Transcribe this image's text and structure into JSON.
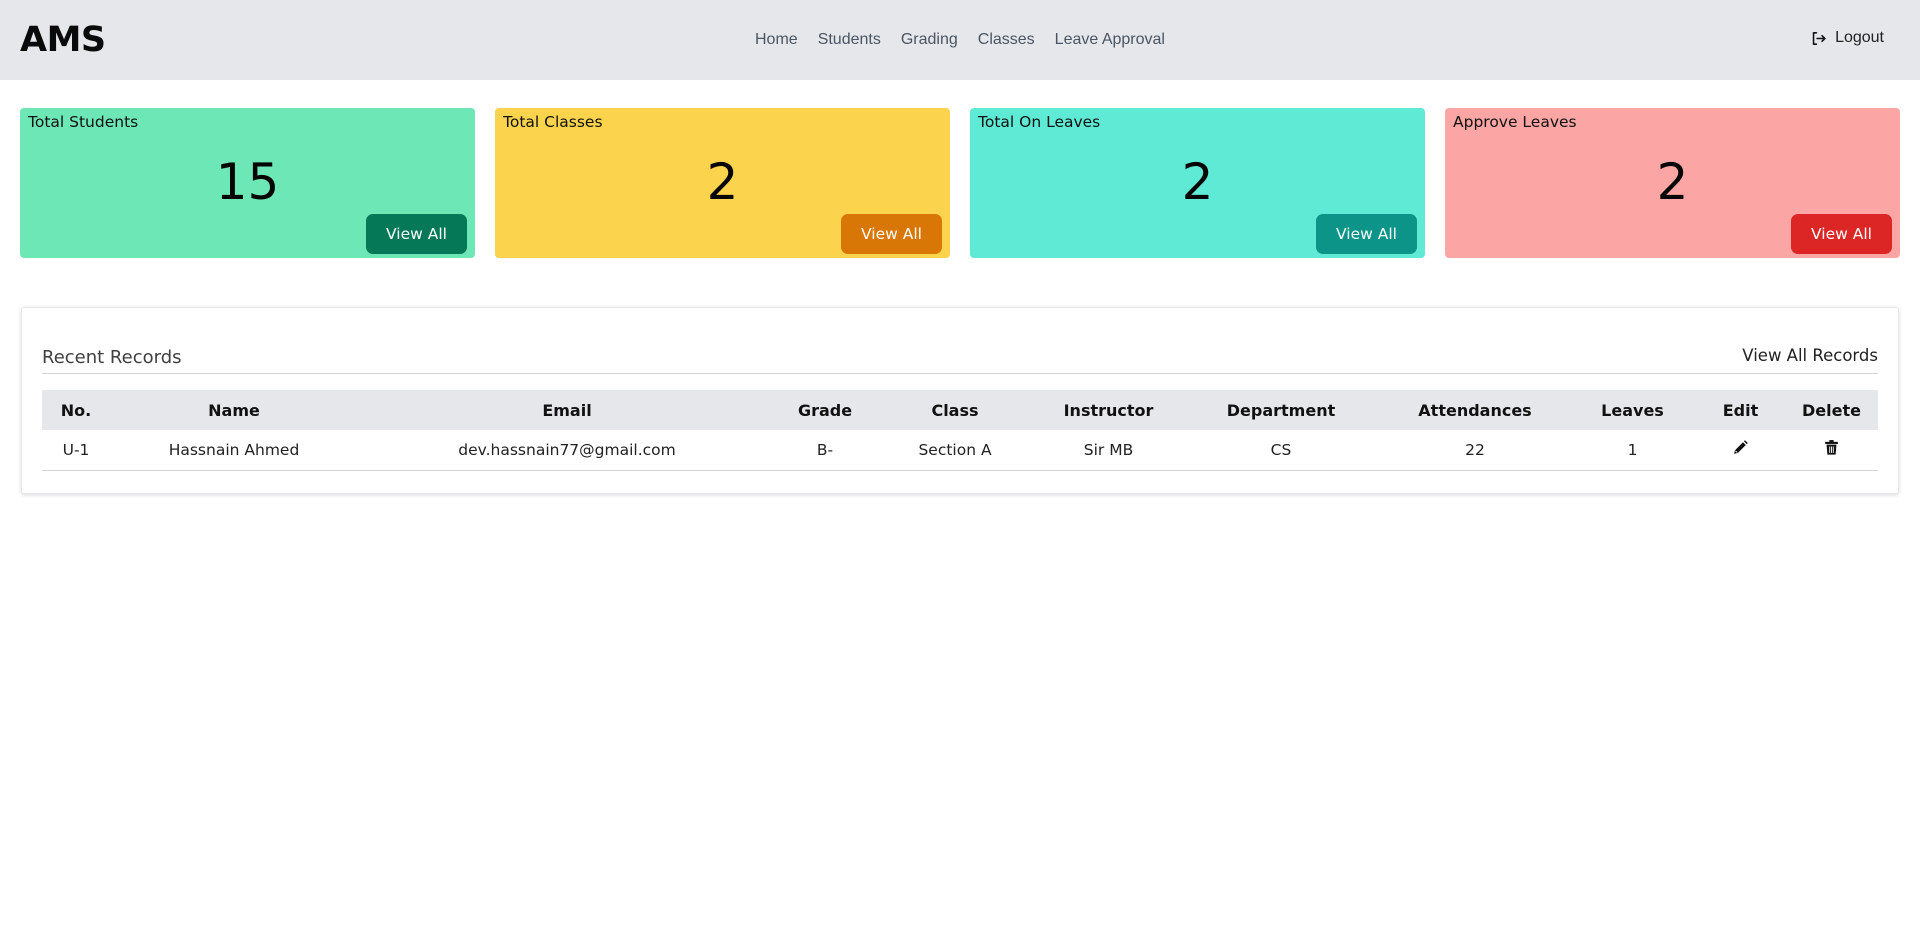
{
  "header": {
    "brand": "AMS",
    "nav": [
      "Home",
      "Students",
      "Grading",
      "Classes",
      "Leave Approval"
    ],
    "logout_label": "Logout",
    "logout_icon": "logout-icon"
  },
  "cards": [
    {
      "title": "Total Students",
      "count": "15",
      "button": "View All",
      "bg": "#6ee7b7",
      "btn": "#047857"
    },
    {
      "title": "Total Classes",
      "count": "2",
      "button": "View All",
      "bg": "#fcd34d",
      "btn": "#d97706"
    },
    {
      "title": "Total On Leaves",
      "count": "2",
      "button": "View All",
      "bg": "#5eead4",
      "btn": "#0d9488"
    },
    {
      "title": "Approve Leaves",
      "count": "2",
      "button": "View All",
      "bg": "#fca5a5",
      "btn": "#dc2626"
    }
  ],
  "records": {
    "title": "Recent Records",
    "view_all": "View All Records",
    "columns": [
      "No.",
      "Name",
      "Email",
      "Grade",
      "Class",
      "Instructor",
      "Department",
      "Attendances",
      "Leaves",
      "Edit",
      "Delete"
    ],
    "rows": [
      {
        "no": "U-1",
        "name": "Hassnain Ahmed",
        "email": "dev.hassnain77@gmail.com",
        "grade": "B-",
        "class": "Section A",
        "instructor": "Sir MB",
        "department": "CS",
        "attendances": "22",
        "leaves": "1",
        "edit_icon": "pencil-icon",
        "delete_icon": "trash-icon"
      }
    ]
  }
}
